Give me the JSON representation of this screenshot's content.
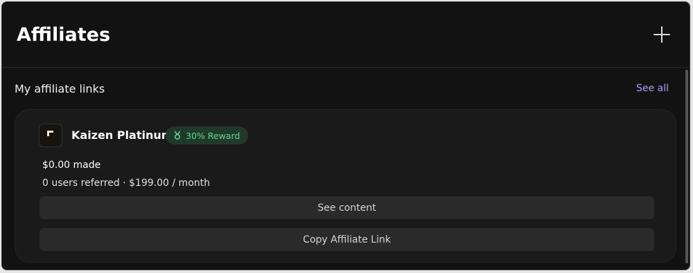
{
  "header": {
    "title": "Affiliates",
    "add_icon": "plus-icon"
  },
  "section": {
    "title": "My affiliate links",
    "see_all_label": "See all",
    "see_all_color": "#a99ff5"
  },
  "affiliate": {
    "logo_icon": "kaizen-logo-icon",
    "name": "Kaizen Platinum",
    "reward": {
      "icon": "gift-icon",
      "label": "30% Reward",
      "color": "#67d593",
      "background": "#1f3a2b"
    },
    "earned": "$0.00 made",
    "meta": "0 users referred · $199.00 / month",
    "see_content_label": "See content",
    "copy_link_label": "Copy Affiliate Link"
  },
  "colors": {
    "background": "#121212",
    "card": "#1a1a1a",
    "button": "#2a2a2a"
  }
}
